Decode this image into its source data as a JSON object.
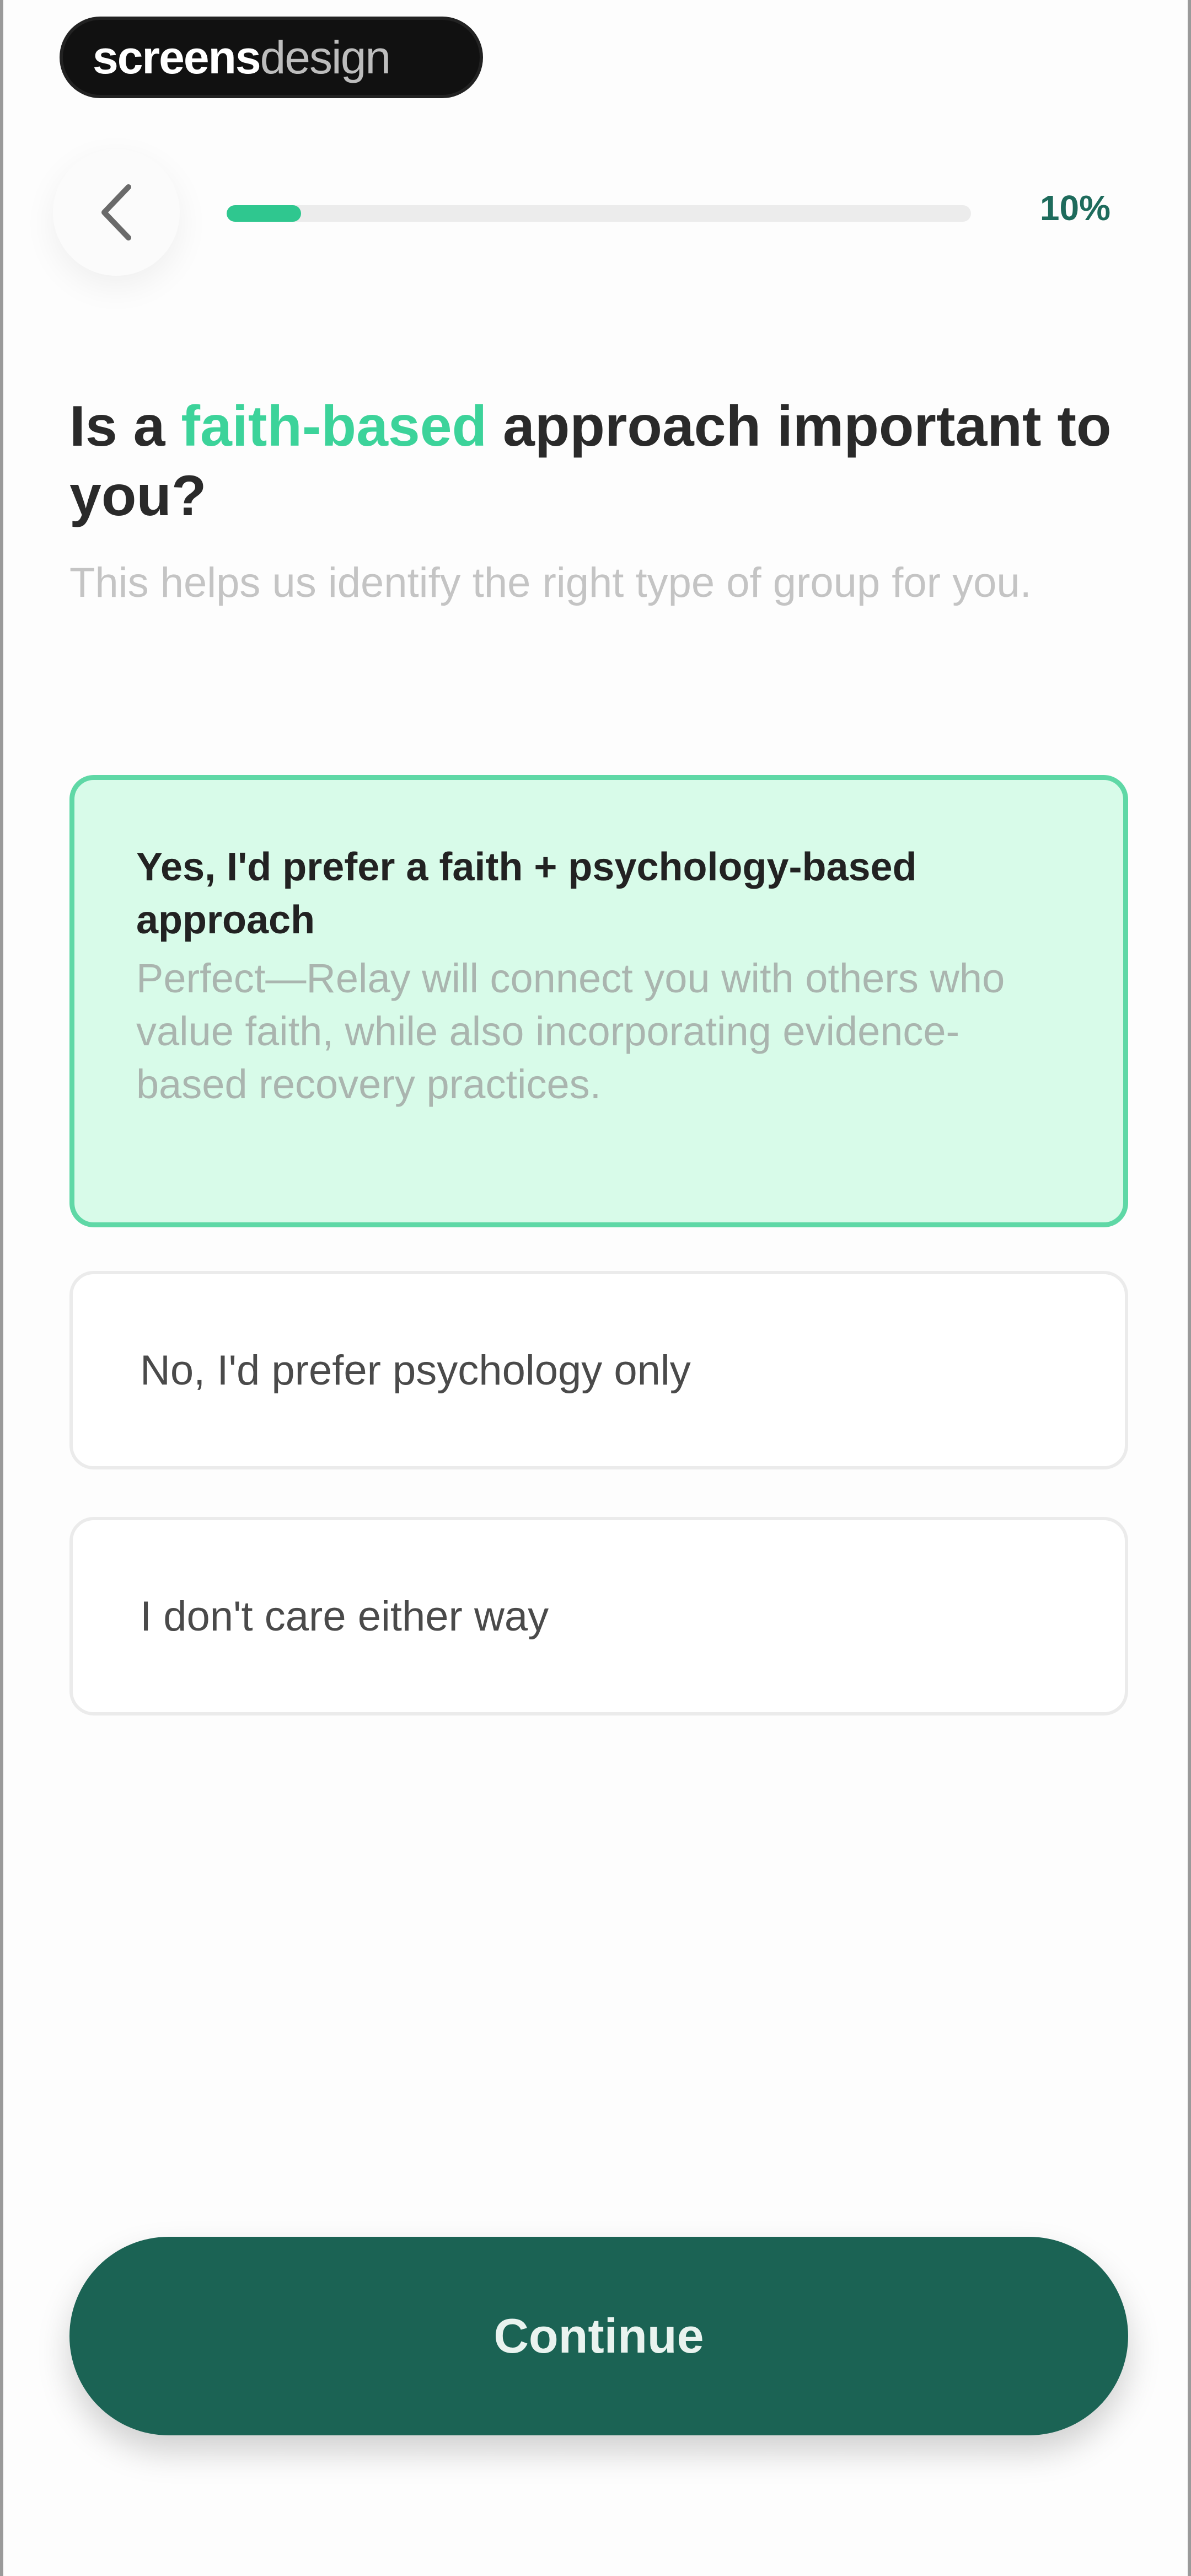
{
  "watermark": {
    "part1": "screens",
    "part2": "design"
  },
  "header": {
    "back_icon": "chevron-left-icon",
    "progress": {
      "value_percent": 10,
      "label": "10%"
    }
  },
  "question": {
    "title_prefix": "Is a ",
    "title_highlight": "faith-based",
    "title_suffix": " approach important to you?",
    "subtitle": "This helps us identify the right type of group for you."
  },
  "options": [
    {
      "title": "Yes, I'd prefer a faith + psychology-based approach",
      "description": "Perfect—Relay will connect you with others who value faith, while also incorporating evidence-based recovery practices.",
      "selected": true
    },
    {
      "title": "No, I'd prefer psychology only",
      "selected": false
    },
    {
      "title": "I don't care either way",
      "selected": false
    }
  ],
  "footer": {
    "continue_label": "Continue"
  },
  "colors": {
    "accent": "#3cd39a",
    "primary": "#1b6354",
    "selected_bg": "#d8fbe9",
    "selected_border": "#5fd8a6"
  }
}
